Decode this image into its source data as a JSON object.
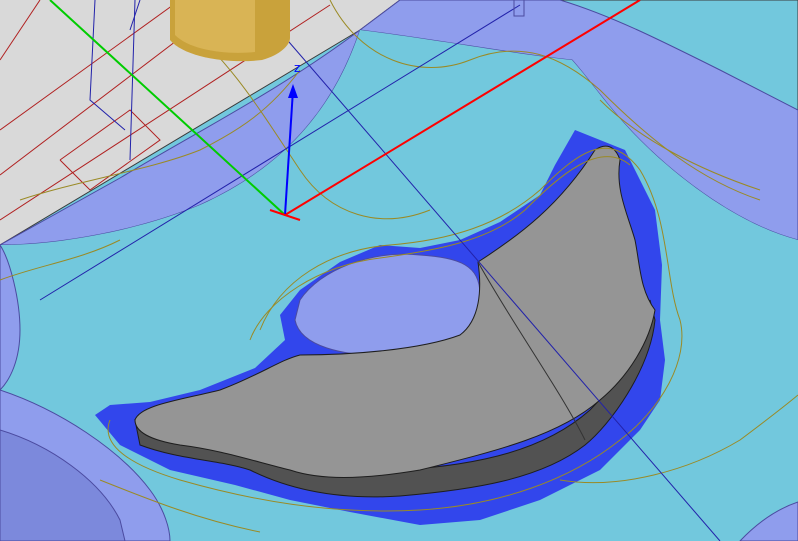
{
  "viewport": {
    "background_color": "#d9d9d9",
    "stock_color": "#72c8dd",
    "pocket_color": "#8f9ded",
    "part_color": "#959595",
    "part_wall_color": "#525252",
    "rest_material_color": "#3246ec",
    "tool_color": "#c9a23b",
    "toolpath_color": "#9a8a25"
  },
  "axes": {
    "x_color": "#ff0000",
    "y_color": "#00cc00",
    "z_color": "#0000ff",
    "z_label": "z"
  },
  "tool": {
    "icon": "end-mill-tool-icon"
  }
}
